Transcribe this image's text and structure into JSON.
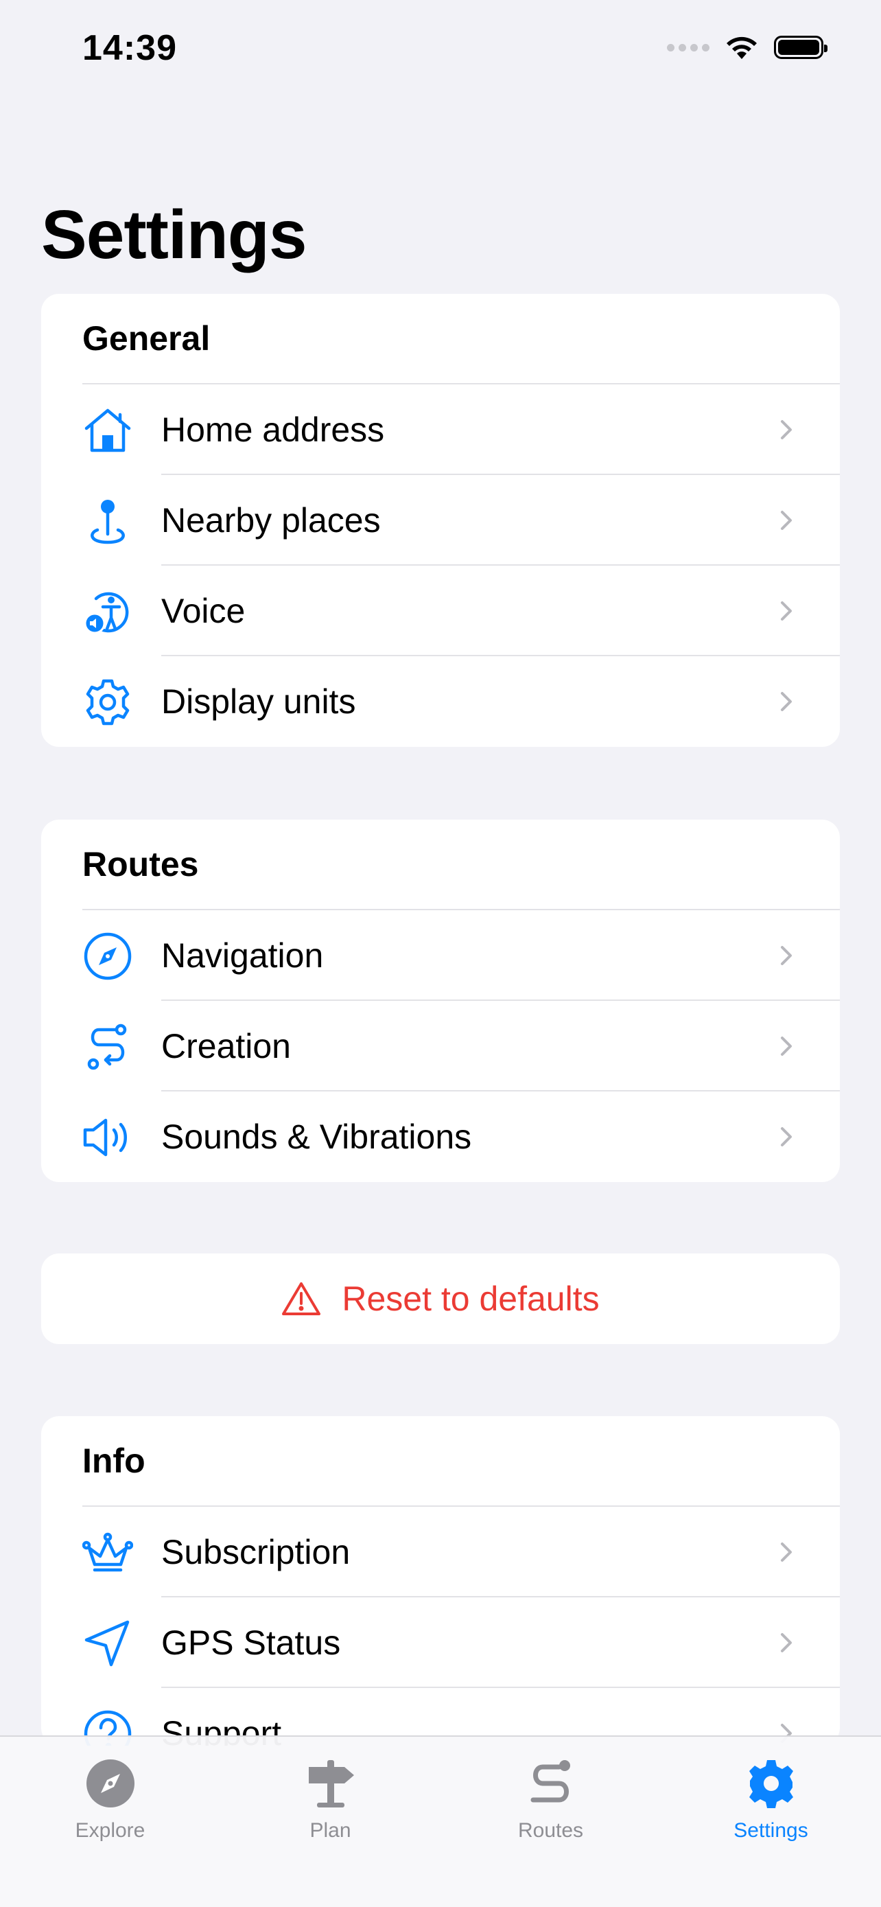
{
  "status_bar": {
    "time": "14:39"
  },
  "page": {
    "title": "Settings"
  },
  "colors": {
    "accent": "#0A84FF",
    "destructive": "#EB3B34",
    "background": "#F2F2F7",
    "inactive_tab": "#8E8E93"
  },
  "general": {
    "header": "General",
    "items": [
      {
        "label": "Home address",
        "icon": "house-icon"
      },
      {
        "label": "Nearby places",
        "icon": "location-pin-icon"
      },
      {
        "label": "Voice",
        "icon": "accessibility-voice-icon"
      },
      {
        "label": "Display units",
        "icon": "gear-icon"
      }
    ]
  },
  "routes": {
    "header": "Routes",
    "items": [
      {
        "label": "Navigation",
        "icon": "compass-icon"
      },
      {
        "label": "Creation",
        "icon": "route-path-icon"
      },
      {
        "label": "Sounds & Vibrations",
        "icon": "speaker-icon"
      }
    ]
  },
  "reset": {
    "label": "Reset to defaults",
    "icon": "warning-triangle-icon"
  },
  "info": {
    "header": "Info",
    "items": [
      {
        "label": "Subscription",
        "icon": "crown-icon"
      },
      {
        "label": "GPS Status",
        "icon": "location-arrow-icon"
      },
      {
        "label": "Support",
        "icon": "question-circle-icon"
      }
    ]
  },
  "tab_bar": {
    "tabs": [
      {
        "label": "Explore",
        "icon": "compass-tab-icon",
        "active": false
      },
      {
        "label": "Plan",
        "icon": "signpost-icon",
        "active": false
      },
      {
        "label": "Routes",
        "icon": "route-tab-icon",
        "active": false
      },
      {
        "label": "Settings",
        "icon": "gear-tab-icon",
        "active": true
      }
    ]
  }
}
